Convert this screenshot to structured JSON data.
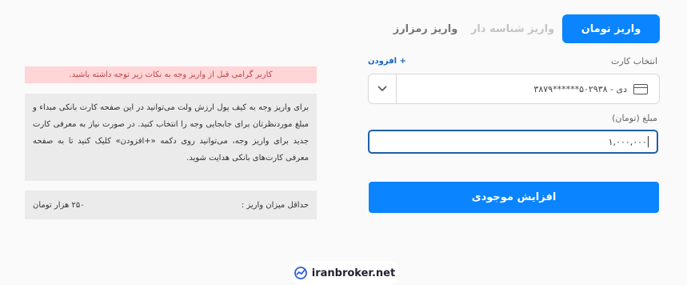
{
  "tabs": {
    "toman": "واریز تومان",
    "identified": "واریز شناسه دار",
    "crypto": "واریز رمزارز"
  },
  "card": {
    "label": "انتخاب کارت",
    "add_link": "+ افزودن",
    "selected": "دی - ۵۰۲۹۳۸******۳۸۷۹"
  },
  "amount": {
    "label": "مبلغ (تومان)",
    "value": "۱,۰۰۰,۰۰۰"
  },
  "submit_label": "افزایش موجودی",
  "notice": {
    "alert": "کاربر گرامی قبل از واریز وجه به نکات زیر توجه داشته باشید.",
    "body": "برای واریز وجه به کیف پول ارزش ولت می‌توانید در این صفحه کارت بانکی مبداء و مبلغ موردنظرتان برای جابجایی وجه را انتخاب کنید. در صورت نیاز به معرفی کارت جدید برای واریز وجه، می‌توانید روی دکمه «+افزودن» کلیک کنید تا به صفحه معرفی کارت‌های بانکی هدایت شوید.",
    "min_label": "حداقل میزان واریز :",
    "min_value": "۲۵۰ هزار تومان"
  },
  "watermark": "iranbroker.net",
  "icons": [
    "credit-card-icon",
    "chevron-down-icon",
    "iranbroker-logo-icon"
  ],
  "colors": {
    "accent": "#0a84ff",
    "alert_bg": "#ffd5d7",
    "panel_bg": "#ebebeb"
  }
}
